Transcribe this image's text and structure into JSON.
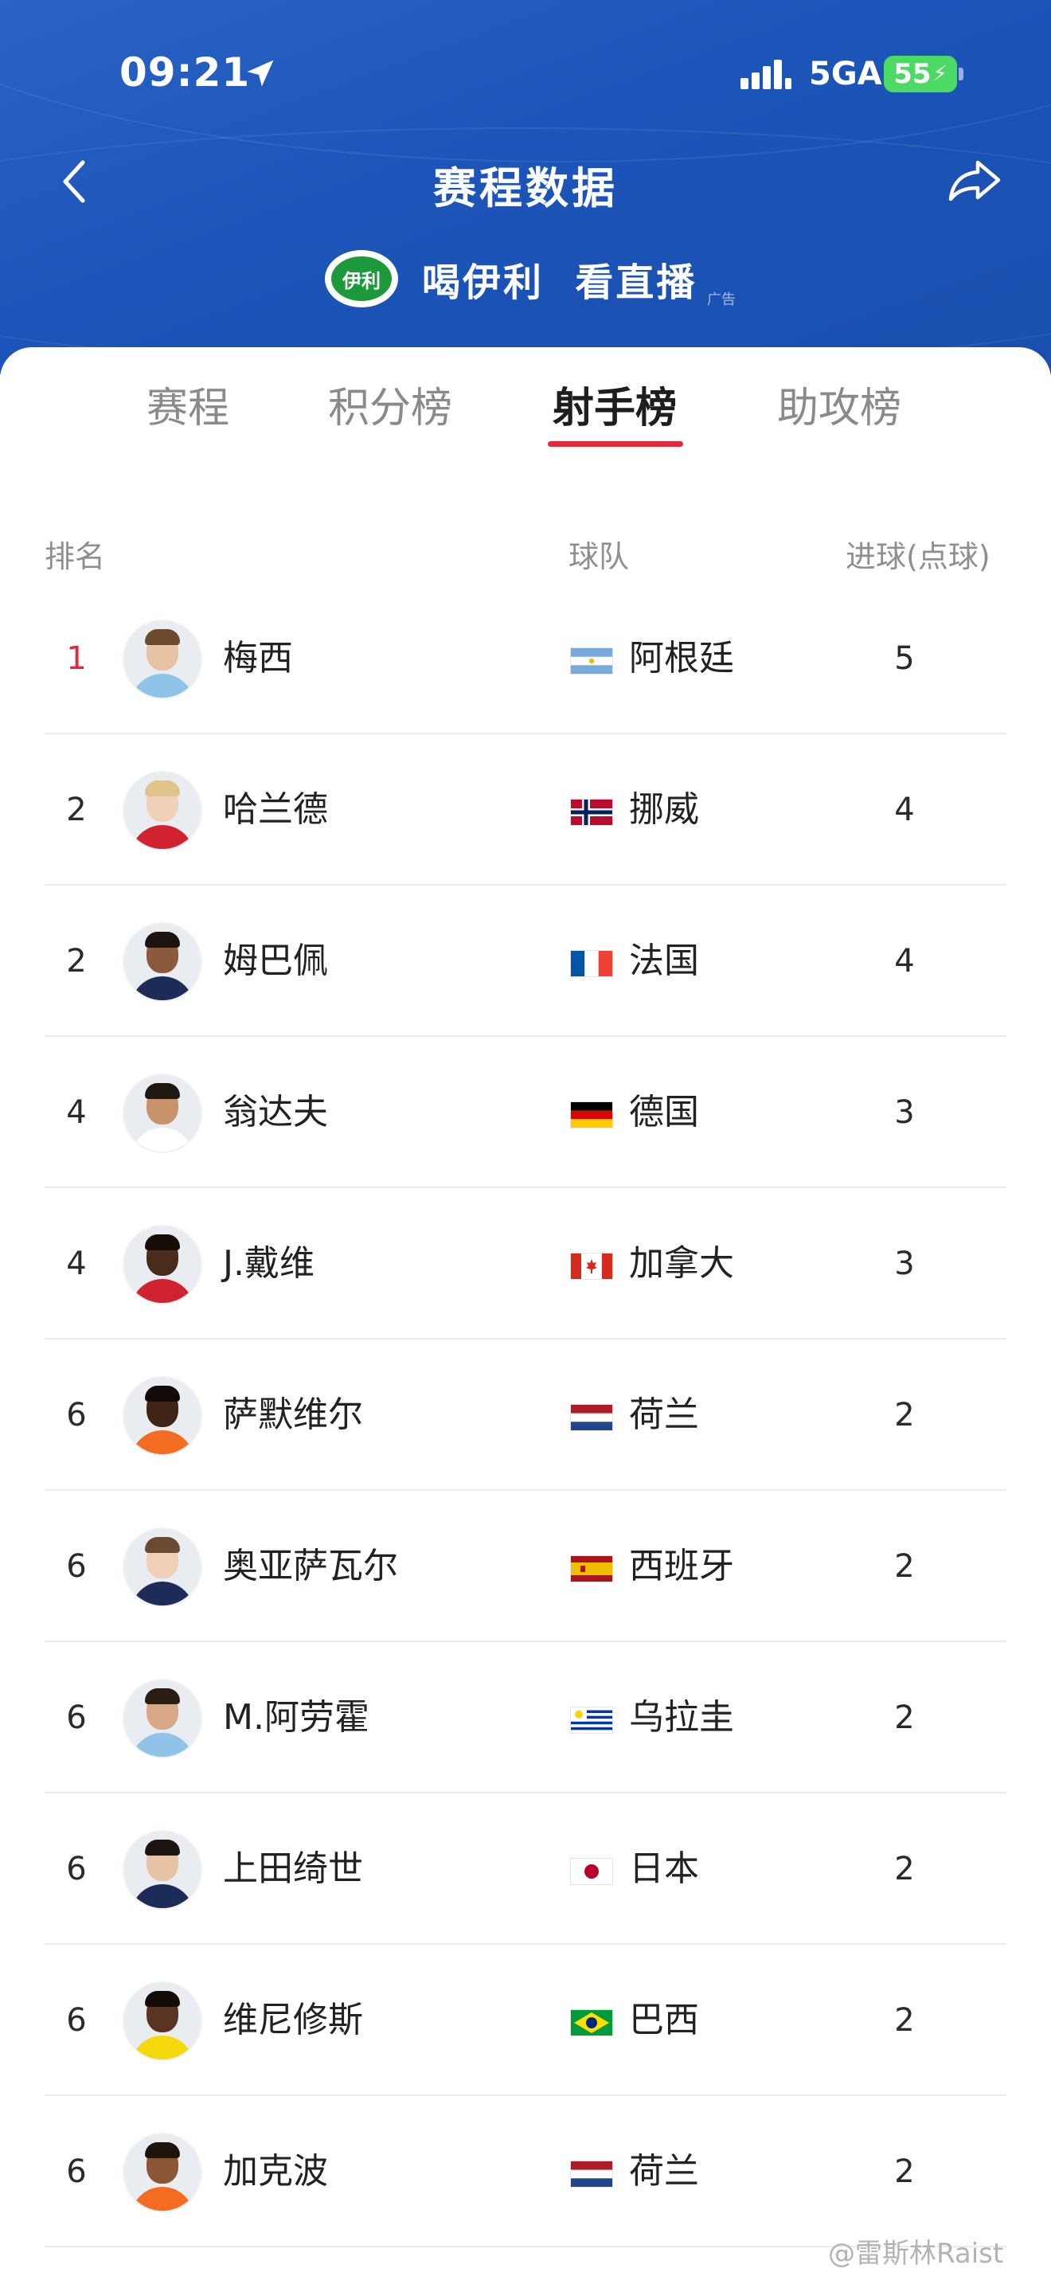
{
  "status_bar": {
    "time": "09:21",
    "network": "5GA",
    "battery": "55"
  },
  "header": {
    "title": "赛程数据",
    "ad_logo_text": "伊利",
    "ad_text": "喝伊利  看直播",
    "ad_tag": "广告"
  },
  "tabs": [
    {
      "label": "赛程",
      "active": false
    },
    {
      "label": "积分榜",
      "active": false
    },
    {
      "label": "射手榜",
      "active": true
    },
    {
      "label": "助攻榜",
      "active": false
    }
  ],
  "table": {
    "headers": {
      "rank": "排名",
      "team": "球队",
      "goals": "进球(点球)"
    },
    "rows": [
      {
        "rank": "1",
        "player": "梅西",
        "team": "阿根廷",
        "goals": "5",
        "flag": "argentina-flag",
        "skin": "#e8c3a3",
        "hair": "#6b4a2e",
        "shirt": "#8fc3e8"
      },
      {
        "rank": "2",
        "player": "哈兰德",
        "team": "挪威",
        "goals": "4",
        "flag": "norway-flag",
        "skin": "#f0d2bb",
        "hair": "#e2c38a",
        "shirt": "#d0232f"
      },
      {
        "rank": "2",
        "player": "姆巴佩",
        "team": "法国",
        "goals": "4",
        "flag": "france-flag",
        "skin": "#8a5a3c",
        "hair": "#1d1410",
        "shirt": "#1d2b58"
      },
      {
        "rank": "4",
        "player": "翁达夫",
        "team": "德国",
        "goals": "3",
        "flag": "germany-flag",
        "skin": "#c8926b",
        "hair": "#1f1712",
        "shirt": "#ffffff"
      },
      {
        "rank": "4",
        "player": "J.戴维",
        "team": "加拿大",
        "goals": "3",
        "flag": "canada-flag",
        "skin": "#4a2c1d",
        "hair": "#150d08",
        "shirt": "#d0232f"
      },
      {
        "rank": "6",
        "player": "萨默维尔",
        "team": "荷兰",
        "goals": "2",
        "flag": "netherlands-flag",
        "skin": "#3f2417",
        "hair": "#120b07",
        "shirt": "#f36c21"
      },
      {
        "rank": "6",
        "player": "奥亚萨瓦尔",
        "team": "西班牙",
        "goals": "2",
        "flag": "spain-flag",
        "skin": "#f0d0b6",
        "hair": "#6a4a30",
        "shirt": "#1d2b58"
      },
      {
        "rank": "6",
        "player": "M.阿劳霍",
        "team": "乌拉圭",
        "goals": "2",
        "flag": "uruguay-flag",
        "skin": "#d9a889",
        "hair": "#2a1d14",
        "shirt": "#8fc3e8"
      },
      {
        "rank": "6",
        "player": "上田绮世",
        "team": "日本",
        "goals": "2",
        "flag": "japan-flag",
        "skin": "#e7c4a6",
        "hair": "#1b1410",
        "shirt": "#1d2b58"
      },
      {
        "rank": "6",
        "player": "维尼修斯",
        "team": "巴西",
        "goals": "2",
        "flag": "brazil-flag",
        "skin": "#5a3523",
        "hair": "#140c07",
        "shirt": "#f5d90d"
      },
      {
        "rank": "6",
        "player": "加克波",
        "team": "荷兰",
        "goals": "2",
        "flag": "netherlands-flag",
        "skin": "#8a5636",
        "hair": "#1e140d",
        "shirt": "#f36c21"
      }
    ]
  },
  "watermark": "@雷斯林Raist",
  "colors": {
    "header_blue": "#1c54b9",
    "accent_red": "#e5273b",
    "battery_green": "#4cd964"
  }
}
